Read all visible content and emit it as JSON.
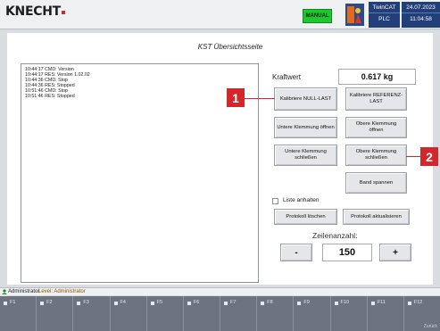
{
  "header": {
    "logo": "KNECHT",
    "mode": "MANUAL",
    "twincat_label": "TwinCAT",
    "plc_label": "PLC",
    "date": "24.07.2023",
    "time": "11:04:58"
  },
  "page": {
    "title": "KST Übersichtsseite"
  },
  "log": {
    "lines": [
      "10:44:17  CMD: Version",
      "10:44:17  RES: Version 1.02.02",
      "10:44:36  CMD: Stop",
      "10:44:36  RES: Stopped",
      "10:51:46  CMD: Stop",
      "10:51:46  RES: Stopped"
    ]
  },
  "kraft": {
    "label": "Kraftwert",
    "value": "0.617 kg"
  },
  "buttons": {
    "calibrate_zero": "Kalibriere NULL-LAST",
    "calibrate_ref": "Kalibriere REFERENZ-LAST",
    "lower_open": "Untere Klemmung öffnen",
    "upper_open": "Obere Klemmung öffnen",
    "lower_close": "Untere Klemmung schließen",
    "upper_close": "Obere Klemmung schließen",
    "band_tension": "Band spannen",
    "delete_log": "Protokoll löschen",
    "refresh_log": "Protokoll aktualisieren",
    "minus": "-",
    "plus": "+"
  },
  "checkbox": {
    "label": "Liste anhalten",
    "checked": false
  },
  "zeilen": {
    "label": "Zeilenanzahl:",
    "value": "150"
  },
  "markers": {
    "m1": "1",
    "m2": "2"
  },
  "status": {
    "user": "Administrator",
    "level": "Level: Administrator"
  },
  "fkeys": [
    "F1",
    "F2",
    "F3",
    "F4",
    "F5",
    "F6",
    "F7",
    "F8",
    "F9",
    "F10",
    "F11",
    "F12"
  ],
  "fkey_sub": "Zurück",
  "colors": {
    "marker": "#d4262b",
    "mode_badge": "#1ec62f",
    "status_box": "#233f7a",
    "fbar": "#6b7480"
  }
}
